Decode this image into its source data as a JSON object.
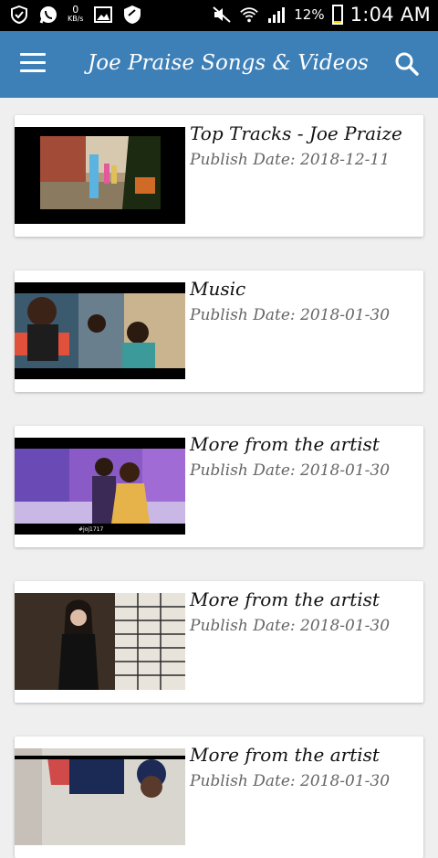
{
  "status_bar": {
    "data_speed_value": "0",
    "data_speed_unit": "KB/s",
    "battery_percent": "12%",
    "time": "1:04 AM"
  },
  "app_bar": {
    "title": "Joe Praise Songs & Videos",
    "menu_icon": "hamburger-menu-icon",
    "search_icon": "search-icon",
    "color": "#3d7fb7"
  },
  "videos": [
    {
      "title": "Top Tracks - Joe Praize",
      "date": "Publish Date: 2018-12-11"
    },
    {
      "title": "Music",
      "date": "Publish Date: 2018-01-30"
    },
    {
      "title": "More from the artist",
      "date": "Publish Date: 2018-01-30"
    },
    {
      "title": "More from the artist",
      "date": "Publish Date: 2018-01-30"
    },
    {
      "title": "More from the artist",
      "date": "Publish Date: 2018-01-30"
    }
  ]
}
